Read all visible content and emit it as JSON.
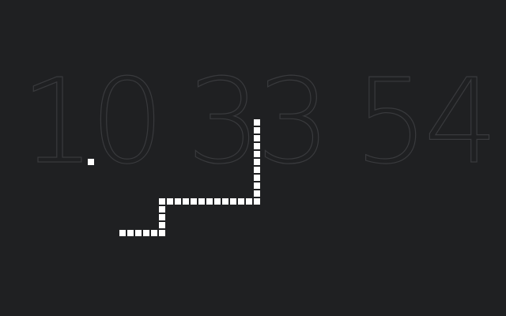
{
  "clock": {
    "hours": "10",
    "minutes": "33",
    "seconds": "54"
  },
  "colors": {
    "background": "#1f2022",
    "clock_digits": "#393a3d",
    "snake": "#ffffff",
    "food": "#ffffff"
  },
  "game": {
    "grid_cell_size": 10,
    "food": {
      "col": 11,
      "row": 20
    },
    "snake_cells": [
      [
        32,
        15
      ],
      [
        32,
        16
      ],
      [
        32,
        17
      ],
      [
        32,
        18
      ],
      [
        32,
        19
      ],
      [
        32,
        20
      ],
      [
        32,
        21
      ],
      [
        32,
        22
      ],
      [
        32,
        23
      ],
      [
        32,
        24
      ],
      [
        32,
        25
      ],
      [
        31,
        25
      ],
      [
        30,
        25
      ],
      [
        29,
        25
      ],
      [
        28,
        25
      ],
      [
        27,
        25
      ],
      [
        26,
        25
      ],
      [
        25,
        25
      ],
      [
        24,
        25
      ],
      [
        23,
        25
      ],
      [
        22,
        25
      ],
      [
        21,
        25
      ],
      [
        20,
        25
      ],
      [
        20,
        26
      ],
      [
        20,
        27
      ],
      [
        20,
        28
      ],
      [
        20,
        29
      ],
      [
        19,
        29
      ],
      [
        18,
        29
      ],
      [
        17,
        29
      ],
      [
        16,
        29
      ],
      [
        15,
        29
      ]
    ]
  }
}
